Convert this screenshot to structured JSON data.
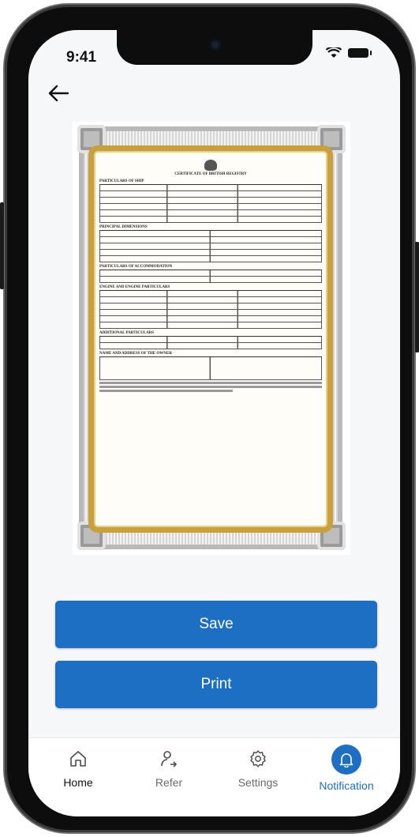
{
  "status_bar": {
    "time": "9:41"
  },
  "header": {
    "back_icon": "arrow-left-icon"
  },
  "document": {
    "icon": "certificate-document-preview",
    "title": "CERTIFICATE OF BRITISH REGISTRY",
    "sections": [
      "PARTICULARS OF SHIP",
      "PRINCIPAL DIMENSIONS",
      "PARTICULARS OF ACCOMMODATION",
      "ENGINE AND ENGINE PARTICULARS",
      "ADDITIONAL PARTICULARS",
      "NAME AND ADDRESS OF THE OWNER"
    ]
  },
  "actions": {
    "save_label": "Save",
    "print_label": "Print"
  },
  "tabs": [
    {
      "label": "Home",
      "icon": "home-icon",
      "active": false
    },
    {
      "label": "Refer",
      "icon": "refer-icon",
      "active": false
    },
    {
      "label": "Settings",
      "icon": "gear-icon",
      "active": false
    },
    {
      "label": "Notification",
      "icon": "bell-icon",
      "active": true
    }
  ],
  "colors": {
    "accent": "#1c6fc2",
    "tab_inactive": "#4a4a4a",
    "tab_active": "#1c6fc2"
  }
}
